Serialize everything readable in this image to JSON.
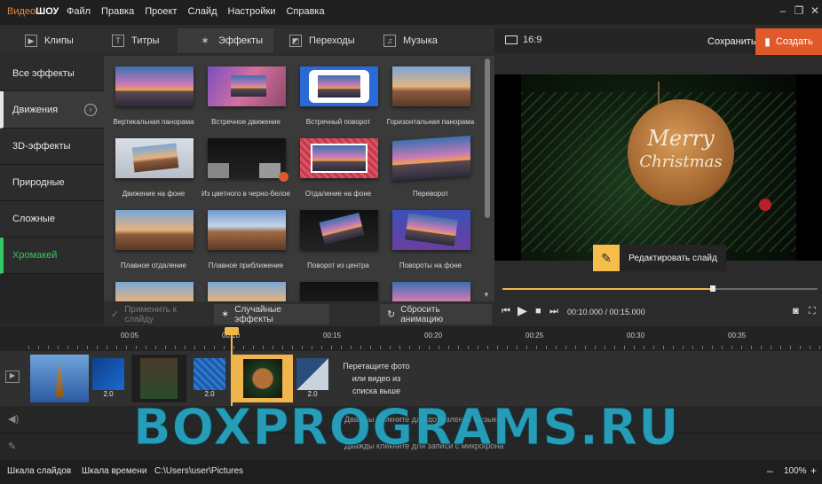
{
  "app": {
    "logo_part1": "Видео",
    "logo_part2": "ШОУ"
  },
  "menu": [
    "Файл",
    "Правка",
    "Проект",
    "Слайд",
    "Настройки",
    "Справка"
  ],
  "window_controls": {
    "minimize": "–",
    "restore": "❐",
    "close": "✕"
  },
  "tabs": [
    "Клипы",
    "Титры",
    "Эффекты",
    "Переходы",
    "Музыка"
  ],
  "active_tab": "Эффекты",
  "header": {
    "ratio": "16:9",
    "save": "Сохранить",
    "create": "Создать"
  },
  "categories": [
    "Все эффекты",
    "Движения",
    "3D-эффекты",
    "Природные",
    "Сложные",
    "Хромакей"
  ],
  "active_category": "Движения",
  "effects": [
    "Вертикальная панорама",
    "Встречное движение",
    "Встречный поворот",
    "Горизонтальная панорама",
    "Движение на фоне",
    "Из цветного в черно-белое",
    "Отдаление на фоне",
    "Переворот",
    "Плавное отдаление",
    "Плавное приближение",
    "Поворот из центра",
    "Повороты на фоне"
  ],
  "actions": {
    "apply": "Применить к слайду",
    "random": "Случайные эффекты",
    "reset": "Сбросить анимацию"
  },
  "preview": {
    "card_line1": "Merry",
    "card_line2": "Christmas",
    "edit_slide": "Редактировать слайд"
  },
  "playback": {
    "time": "00:10.000 / 00:15.000",
    "progress": 0.667
  },
  "ruler_ticks": [
    "00:05",
    "00:10",
    "00:15",
    "00:20",
    "00:25",
    "00:30",
    "00:35"
  ],
  "transitions": [
    "2.0",
    "2.0",
    "2.0",
    "2.0"
  ],
  "drop_hint": "Перетащите фото или видео из списка выше",
  "audio_hint": "Дважды кликните для добавления музыки",
  "mic_hint": "Дважды кликните для записи с микрофона",
  "watermark": "BOXPROGRAMS.RU",
  "statusbar": {
    "slides": "Шкала слайдов",
    "timeline": "Шкала времени",
    "path": "C:\\Users\\user\\Pictures",
    "zoom": "100%",
    "minus": "–",
    "plus": "+"
  }
}
